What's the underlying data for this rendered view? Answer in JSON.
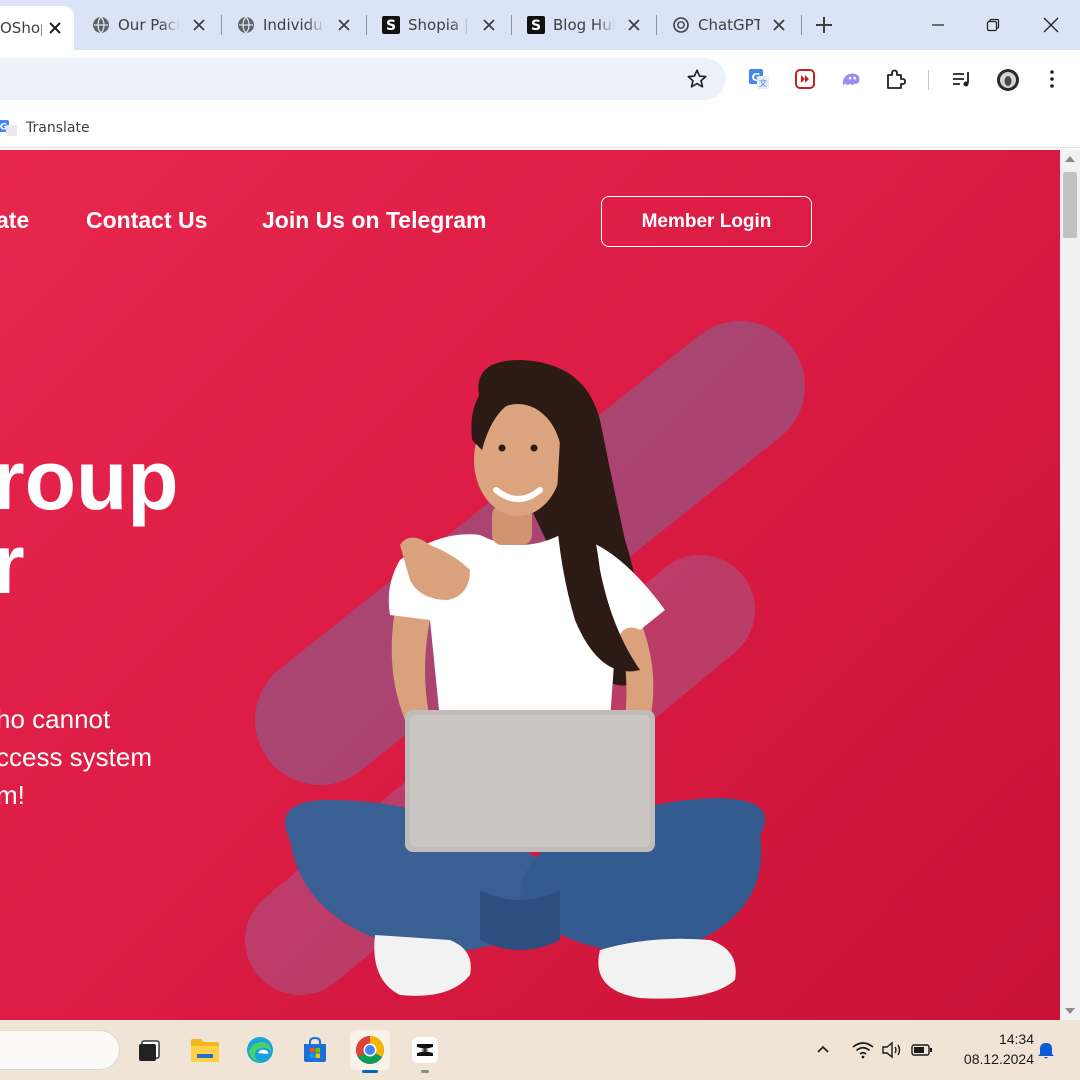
{
  "browser": {
    "tabs": [
      {
        "title": "OShopia",
        "favicon": "shop-icon",
        "active": true
      },
      {
        "title": "Our Packages",
        "favicon": "globe-icon",
        "active": false
      },
      {
        "title": "Individual",
        "favicon": "globe-icon",
        "active": false
      },
      {
        "title": "Shopia |",
        "favicon": "s-logo-icon",
        "active": false
      },
      {
        "title": "Blog Hub",
        "favicon": "s-logo-icon",
        "active": false
      },
      {
        "title": "ChatGPT",
        "favicon": "openai-icon",
        "active": false
      }
    ],
    "new_tab_icon": "plus-icon",
    "window_controls": [
      "minimize-icon",
      "restore-icon",
      "close-icon"
    ],
    "toolbar_icons": [
      "star-icon",
      "google-translate-icon",
      "video-speed-icon",
      "ghost-extension-icon",
      "puzzle-icon",
      "media-control-icon",
      "profile-avatar",
      "more-menu-icon"
    ],
    "bookmarks": [
      {
        "label": "Translate",
        "icon": "google-translate-icon"
      }
    ]
  },
  "page": {
    "nav": {
      "item_partial": "ate",
      "contact": "Contact Us",
      "telegram": "Join Us on Telegram",
      "login": "Member Login"
    },
    "hero": {
      "title_line1": "roup",
      "title_line2": "r",
      "subtitle_line1": "ho cannot",
      "subtitle_line2": "ccess system",
      "subtitle_line3": "m!"
    },
    "colors": {
      "hero_bg": "#dc1c44",
      "accent_stripe": "#a34a7a",
      "text": "#ffffff"
    }
  },
  "taskbar": {
    "apps": [
      "task-view-icon",
      "file-explorer-icon",
      "edge-icon",
      "store-icon",
      "chrome-icon",
      "capcut-icon"
    ],
    "tray_icons": [
      "chevron-up-icon",
      "wifi-icon",
      "volume-icon",
      "battery-icon",
      "notification-bell-icon"
    ],
    "time": "14:34",
    "date": "08.12.2024"
  }
}
